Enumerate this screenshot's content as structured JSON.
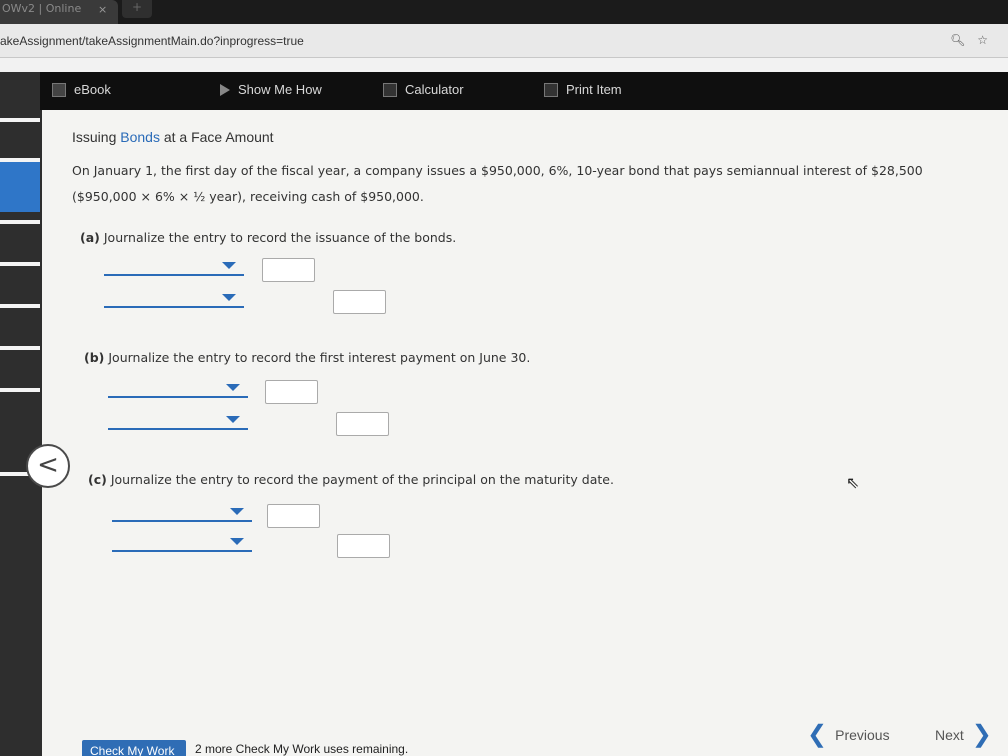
{
  "browser": {
    "tab_title": "OWv2 | Online",
    "tab_close": "×",
    "new_tab": "+",
    "url": "akeAssignment/takeAssignmentMain.do?inprogress=true",
    "zoom_icon": "zoom-icon",
    "star_icon": "star-icon"
  },
  "toolbar": {
    "ebook": "eBook",
    "show_me_how": "Show Me How",
    "calculator": "Calculator",
    "print_item": "Print Item"
  },
  "problem": {
    "title_prefix": "Issuing ",
    "title_link": "Bonds",
    "title_suffix": " at a Face Amount",
    "line1": "On January 1, the first day of the fiscal year, a company issues a $950,000, 6%, 10-year bond that pays semiannual interest of $28,500",
    "line2": "($950,000 × 6% × ½ year), receiving cash of $950,000."
  },
  "parts": [
    {
      "letter": "(a)",
      "text": "Journalize the entry to record the issuance of the bonds."
    },
    {
      "letter": "(b)",
      "text": "Journalize the entry to record the first interest payment on June 30."
    },
    {
      "letter": "(c)",
      "text": "Journalize the entry to record the payment of the principal on the maturity date."
    }
  ],
  "footer": {
    "check_my_work": "Check My Work",
    "remaining": "2 more Check My Work uses remaining.",
    "previous": "Previous",
    "next": "Next"
  },
  "colors": {
    "accent": "#2f6db5",
    "toolbar_bg": "#0f0f0f",
    "sidebar_active": "#2f76c8"
  }
}
